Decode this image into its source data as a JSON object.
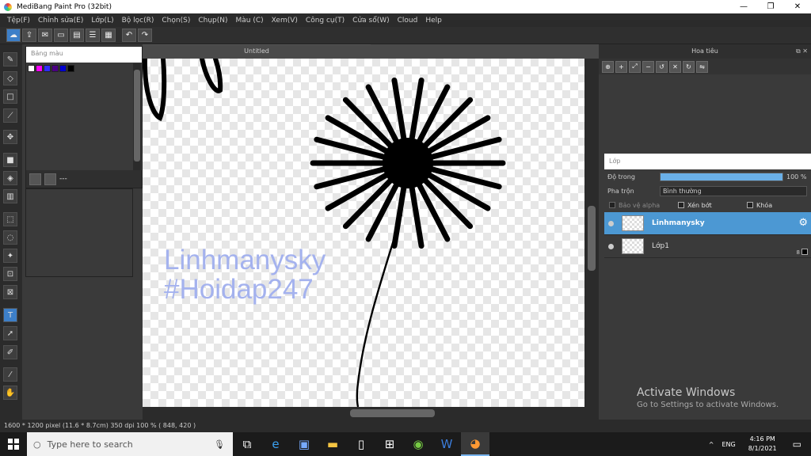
{
  "window": {
    "title": "MediBang Paint Pro (32bit)",
    "minimize": "—",
    "maximize": "❐",
    "close": "✕"
  },
  "menu": [
    "Tệp(F)",
    "Chỉnh sửa(E)",
    "Lớp(L)",
    "Bộ lọc(R)",
    "Chọn(S)",
    "Chụp(N)",
    "Màu (C)",
    "Xem(V)",
    "Công cụ(T)",
    "Cửa sổ(W)",
    "Cloud",
    "Help"
  ],
  "color_panel": {
    "title": "Bảng màu",
    "swatches": [
      "#ffffff",
      "#ff00ff",
      "#2e2eff",
      "#4b0082",
      "#0000cd",
      "#000000"
    ],
    "footer_text": "---"
  },
  "document": {
    "tab_title": "Untitled"
  },
  "canvas": {
    "text_line1": "Linhmanysky",
    "text_line2": "#Hoidap247"
  },
  "navigator": {
    "title": "Hoa tiêu"
  },
  "layers": {
    "title": "Lớp",
    "opacity_label": "Độ trong",
    "opacity_value": "100 %",
    "opacity_percent": 100,
    "blend_label": "Pha trộn",
    "blend_value": "Bình thường",
    "protect_alpha": "Bảo vệ alpha",
    "clip": "Xén bớt",
    "lock": "Khóa",
    "items": [
      {
        "name": "Linhmanysky",
        "selected": true
      },
      {
        "name": "Lớp1",
        "selected": false,
        "number": "8"
      }
    ]
  },
  "activation": {
    "line1": "Activate Windows",
    "line2": "Go to Settings to activate Windows."
  },
  "status": {
    "text": "1600 * 1200 pixel   (11.6 * 8.7cm)   350 dpi   100 %   ( 848, 420 )"
  },
  "taskbar": {
    "search_placeholder": "Type here to search",
    "lang": "ENG",
    "time": "4:16 PM",
    "date": "8/1/2021"
  }
}
